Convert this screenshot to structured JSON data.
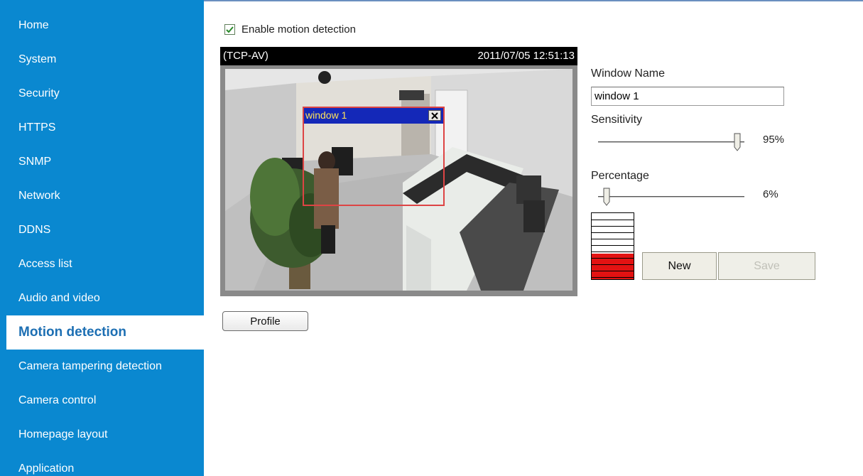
{
  "sidebar": {
    "items": [
      {
        "label": "Home",
        "active": false
      },
      {
        "label": "System",
        "active": false
      },
      {
        "label": "Security",
        "active": false
      },
      {
        "label": "HTTPS",
        "active": false
      },
      {
        "label": "SNMP",
        "active": false
      },
      {
        "label": "Network",
        "active": false
      },
      {
        "label": "DDNS",
        "active": false
      },
      {
        "label": "Access list",
        "active": false
      },
      {
        "label": "Audio and video",
        "active": false
      },
      {
        "label": "Motion detection",
        "active": true
      },
      {
        "label": "Camera tampering detection",
        "active": false
      },
      {
        "label": "Camera control",
        "active": false
      },
      {
        "label": "Homepage layout",
        "active": false
      },
      {
        "label": "Application",
        "active": false
      }
    ]
  },
  "motion": {
    "enable_label": "Enable motion detection",
    "enable_checked": true
  },
  "video": {
    "stream": "(TCP-AV)",
    "timestamp": "2011/07/05 12:51:13",
    "window_title": "window 1"
  },
  "settings": {
    "window_name_label": "Window Name",
    "window_name_value": "window 1",
    "sensitivity_label": "Sensitivity",
    "sensitivity_value": 95,
    "sensitivity_text": "95%",
    "percentage_label": "Percentage",
    "percentage_value": 6,
    "percentage_text": "6%"
  },
  "buttons": {
    "new_label": "New",
    "save_label": "Save",
    "profile_label": "Profile"
  },
  "colors": {
    "sidebar_bg": "#0a88d0",
    "active_text": "#1d6fb3",
    "window_title_bg": "#1428b8",
    "level_fill": "#e31212"
  }
}
